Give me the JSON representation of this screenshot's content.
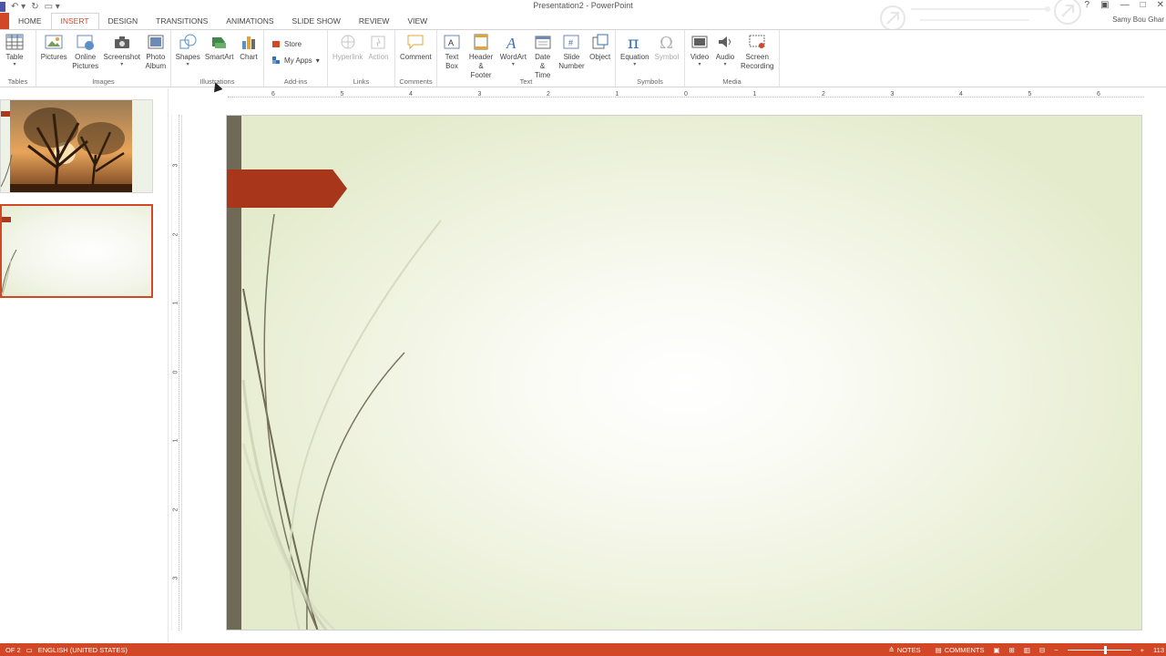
{
  "window": {
    "title": "Presentation2 - PowerPoint",
    "user": "Samy Bou Ghar",
    "controls": [
      "?",
      "▣",
      "—",
      "□",
      "✕"
    ]
  },
  "tabs": [
    {
      "label": "HOME",
      "active": false
    },
    {
      "label": "INSERT",
      "active": true
    },
    {
      "label": "DESIGN",
      "active": false
    },
    {
      "label": "TRANSITIONS",
      "active": false
    },
    {
      "label": "ANIMATIONS",
      "active": false
    },
    {
      "label": "SLIDE SHOW",
      "active": false
    },
    {
      "label": "REVIEW",
      "active": false
    },
    {
      "label": "VIEW",
      "active": false
    }
  ],
  "ribbon": {
    "tables": {
      "label": "Tables",
      "table": "Table"
    },
    "images": {
      "label": "Images",
      "pictures": "Pictures",
      "online_pictures_1": "Online",
      "online_pictures_2": "Pictures",
      "screenshot": "Screenshot",
      "photo_album_1": "Photo",
      "photo_album_2": "Album"
    },
    "illustrations": {
      "label": "Illustrations",
      "shapes": "Shapes",
      "smartart": "SmartArt",
      "chart": "Chart"
    },
    "addins": {
      "label": "Add-ins",
      "store": "Store",
      "my_apps": "My Apps"
    },
    "links": {
      "label": "Links",
      "hyperlink": "Hyperlink",
      "action": "Action"
    },
    "comments": {
      "label": "Comments",
      "comment": "Comment"
    },
    "text": {
      "label": "Text",
      "text_box_1": "Text",
      "text_box_2": "Box",
      "header_footer_1": "Header",
      "header_footer_2": "& Footer",
      "wordart": "WordArt",
      "date_time_1": "Date &",
      "date_time_2": "Time",
      "slide_number_1": "Slide",
      "slide_number_2": "Number",
      "object": "Object"
    },
    "symbols": {
      "label": "Symbols",
      "equation": "Equation",
      "symbol": "Symbol"
    },
    "media": {
      "label": "Media",
      "video": "Video",
      "audio": "Audio",
      "screen_recording_1": "Screen",
      "screen_recording_2": "Recording"
    }
  },
  "ruler": {
    "horizontal": [
      "6",
      "5",
      "4",
      "3",
      "2",
      "1",
      "0",
      "1",
      "2",
      "3",
      "4",
      "5",
      "6"
    ],
    "vertical": [
      "3",
      "2",
      "1",
      "0",
      "1",
      "2",
      "3"
    ]
  },
  "status": {
    "slide": "OF 2",
    "language": "ENGLISH (UNITED STATES)",
    "notes": "NOTES",
    "comments": "COMMENTS",
    "zoom": "113"
  },
  "colors": {
    "accent": "#d24726",
    "slide_bar": "#6f6a55",
    "slide_arrow": "#a8361b"
  }
}
